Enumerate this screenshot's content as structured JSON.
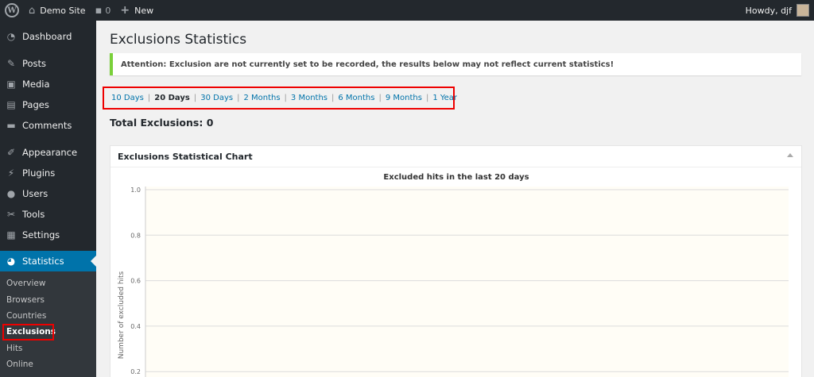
{
  "adminbar": {
    "site_name": "Demo Site",
    "comments_count": "0",
    "new_label": "New",
    "howdy": "Howdy, djf"
  },
  "sidebar": {
    "items": [
      {
        "label": "Dashboard",
        "icon": "dashboard-icon"
      },
      {
        "label": "Posts",
        "icon": "pin-icon"
      },
      {
        "label": "Media",
        "icon": "media-icon"
      },
      {
        "label": "Pages",
        "icon": "pages-icon"
      },
      {
        "label": "Comments",
        "icon": "comments-icon"
      },
      {
        "label": "Appearance",
        "icon": "brush-icon"
      },
      {
        "label": "Plugins",
        "icon": "plug-icon"
      },
      {
        "label": "Users",
        "icon": "user-icon"
      },
      {
        "label": "Tools",
        "icon": "wrench-icon"
      },
      {
        "label": "Settings",
        "icon": "settings-icon"
      },
      {
        "label": "Statistics",
        "icon": "pie-chart-icon"
      }
    ],
    "submenu": [
      "Overview",
      "Browsers",
      "Countries",
      "Exclusions",
      "Hits",
      "Online"
    ]
  },
  "page": {
    "title": "Exclusions Statistics",
    "notice": "Attention: Exclusion are not currently set to be recorded, the results below may not reflect current statistics!",
    "ranges": [
      "10 Days",
      "20 Days",
      "30 Days",
      "2 Months",
      "3 Months",
      "6 Months",
      "9 Months",
      "1 Year"
    ],
    "current_range": "20 Days",
    "total_label": "Total Exclusions: 0",
    "postbox_title": "Exclusions Statistical Chart"
  },
  "chart_data": {
    "type": "line",
    "title": "Excluded hits in the last 20 days",
    "ylabel": "Number of excluded hits",
    "xlabel": "",
    "yticks": [
      "1.0",
      "0.8",
      "0.6",
      "0.4",
      "0.2"
    ],
    "ylim": [
      0,
      1
    ],
    "grid": true,
    "series": []
  },
  "colors": {
    "accent": "#0073aa",
    "sidebar_bg": "#23282d",
    "notice_border": "#7ad03a",
    "highlight": "#ee0000",
    "plot_bg": "#fffdf6"
  }
}
